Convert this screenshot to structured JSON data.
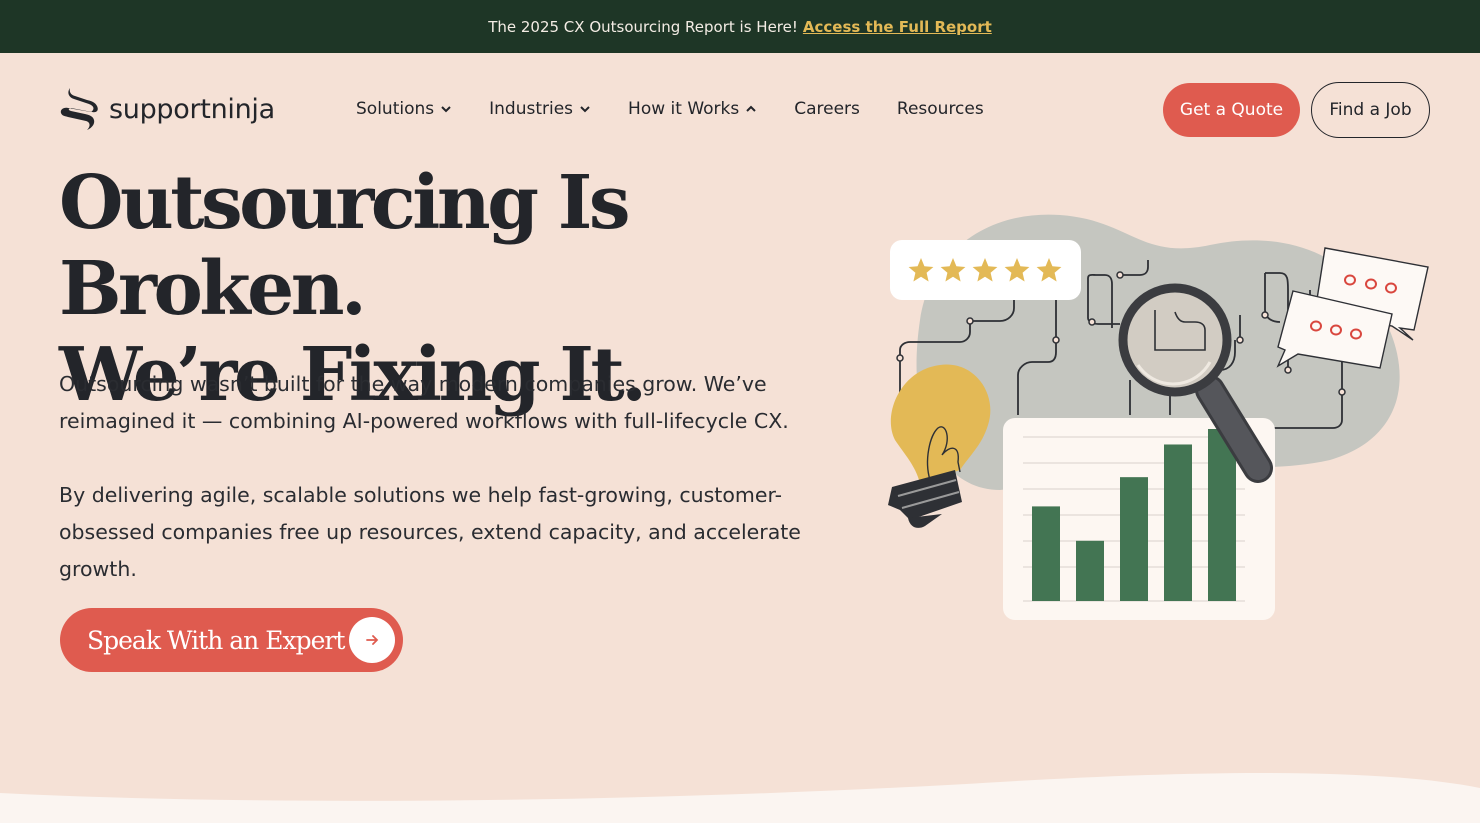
{
  "banner": {
    "text": "The 2025 CX Outsourcing Report is Here!",
    "link_text": "Access the Full Report"
  },
  "brand": {
    "name": "supportninja"
  },
  "nav": {
    "items": [
      {
        "label": "Solutions",
        "icon": "chevron-down-icon"
      },
      {
        "label": "Industries",
        "icon": "chevron-down-icon"
      },
      {
        "label": "How it Works",
        "icon": "chevron-up-icon"
      },
      {
        "label": "Careers"
      },
      {
        "label": "Resources"
      }
    ]
  },
  "actions": {
    "quote_label": "Get a Quote",
    "job_label": "Find a Job"
  },
  "hero": {
    "headline_line1": "Outsourcing Is Broken.",
    "headline_line2": "We’re Fixing It.",
    "paragraph1": "Outsourcing wasn’t built for the way modern companies grow. We’ve reimagined it — combining AI-powered workflows with full-lifecycle CX.",
    "paragraph2": "By delivering agile, scalable solutions we help fast-growing, customer-obsessed companies free up resources, extend capacity, and accelerate growth.",
    "cta_label": "Speak With an Expert"
  },
  "illustration": {
    "rating_stars": 5,
    "bar_values": [
      0.55,
      0.35,
      0.72,
      0.91,
      1.0
    ],
    "colors": {
      "star": "#e3b956",
      "bar": "#437553",
      "bulb": "#e3b956",
      "blob": "#c5c6c0",
      "bubble_dots": "#d9473e"
    }
  },
  "colors": {
    "accent": "#df5b4f",
    "banner_bg": "#1e3626",
    "banner_link": "#e3b956",
    "page_bg": "#f5e1d6"
  }
}
